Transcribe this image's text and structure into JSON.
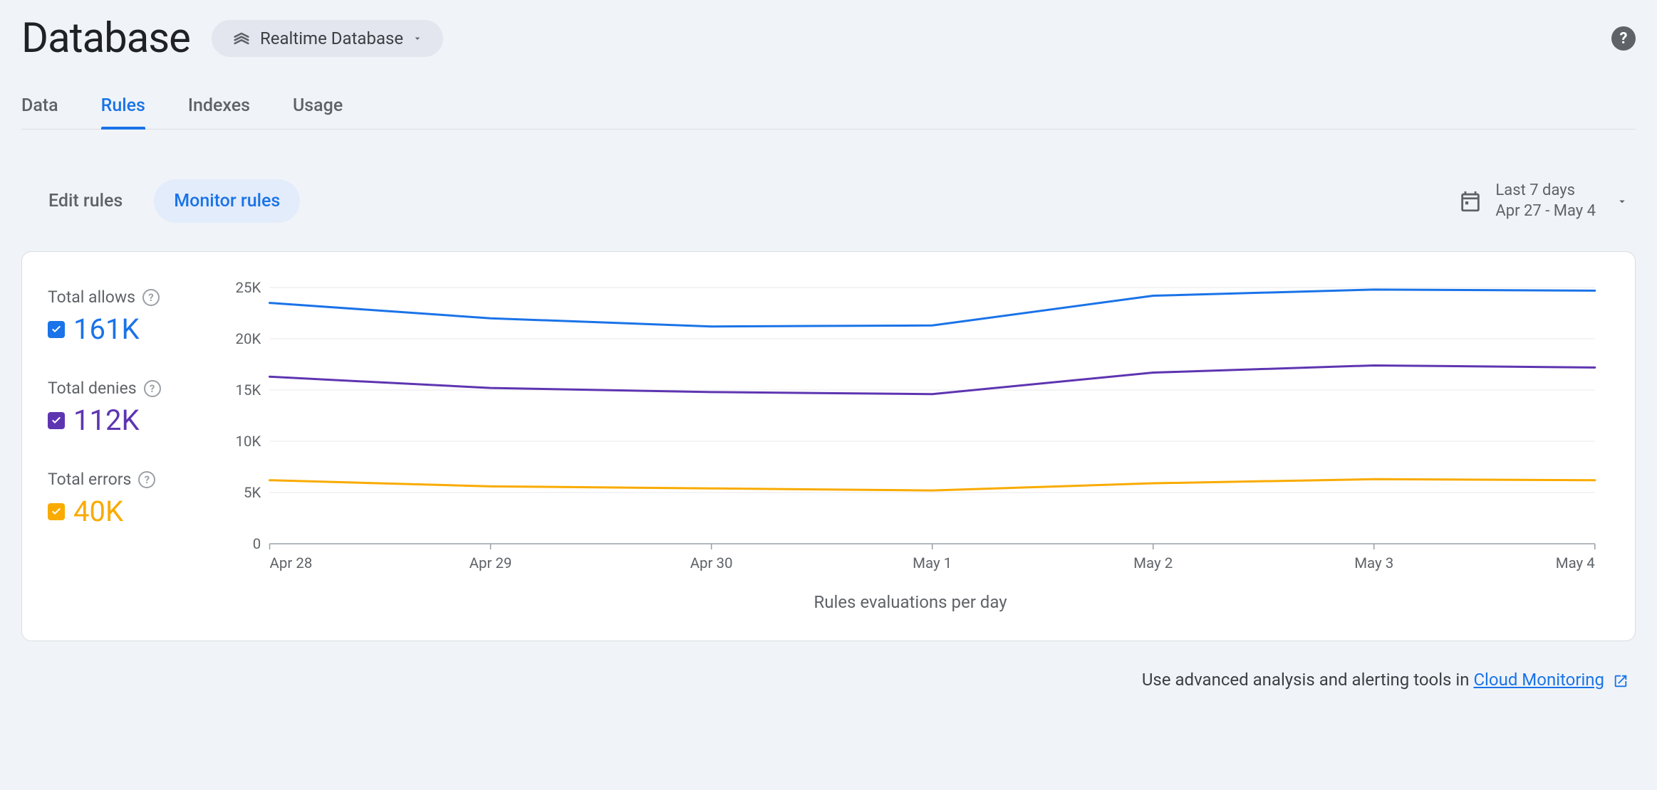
{
  "header": {
    "title": "Database",
    "db_selector_label": "Realtime Database"
  },
  "tabs": [
    {
      "label": "Data",
      "active": false
    },
    {
      "label": "Rules",
      "active": true
    },
    {
      "label": "Indexes",
      "active": false
    },
    {
      "label": "Usage",
      "active": false
    }
  ],
  "subtabs": [
    {
      "label": "Edit rules",
      "active": false
    },
    {
      "label": "Monitor rules",
      "active": true
    }
  ],
  "date_picker": {
    "range_label": "Last 7 days",
    "range_dates": "Apr 27 - May 4"
  },
  "legend": {
    "allows": {
      "label": "Total allows",
      "value": "161K",
      "color": "#1a73e8"
    },
    "denies": {
      "label": "Total denies",
      "value": "112K",
      "color": "#5e35b1"
    },
    "errors": {
      "label": "Total errors",
      "value": "40K",
      "color": "#f9ab00"
    }
  },
  "chart_data": {
    "type": "line",
    "title": "",
    "xlabel": "Rules evaluations per day",
    "ylabel": "",
    "ylim": [
      0,
      25000
    ],
    "yticks": [
      0,
      5000,
      10000,
      15000,
      20000,
      25000
    ],
    "ytick_labels": [
      "0",
      "5K",
      "10K",
      "15K",
      "20K",
      "25K"
    ],
    "categories": [
      "Apr 28",
      "Apr 29",
      "Apr 30",
      "May 1",
      "May 2",
      "May 3",
      "May 4"
    ],
    "series": [
      {
        "name": "Total allows",
        "color": "#1a73e8",
        "values": [
          23500,
          22000,
          21200,
          21300,
          24200,
          24800,
          24700
        ]
      },
      {
        "name": "Total denies",
        "color": "#5e35b1",
        "values": [
          16300,
          15200,
          14800,
          14600,
          16700,
          17400,
          17200
        ]
      },
      {
        "name": "Total errors",
        "color": "#f9ab00",
        "values": [
          6200,
          5600,
          5400,
          5200,
          5900,
          6300,
          6200
        ]
      }
    ]
  },
  "footer": {
    "text_prefix": "Use advanced analysis and alerting tools in ",
    "link_text": "Cloud Monitoring"
  }
}
